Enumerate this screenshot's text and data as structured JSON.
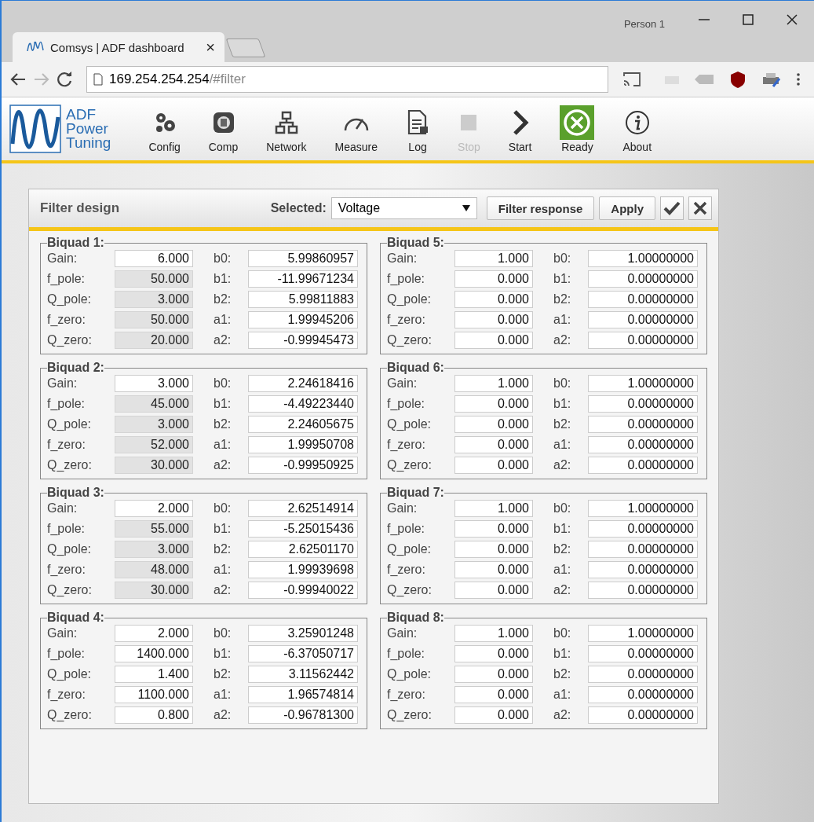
{
  "browser": {
    "profile": "Person 1",
    "tab_title": "Comsys | ADF dashboard",
    "tab_close": "×",
    "url_host": "169.254.254.254",
    "url_path": "/#filter"
  },
  "app": {
    "logo_text": [
      "ADF",
      "Power",
      "Tuning"
    ],
    "toolbar": [
      {
        "label": "Config",
        "kind": "config",
        "disabled": false
      },
      {
        "label": "Comp",
        "kind": "comp",
        "disabled": false
      },
      {
        "label": "Network",
        "kind": "network",
        "disabled": false
      },
      {
        "label": "Measure",
        "kind": "measure",
        "disabled": false
      },
      {
        "label": "Log",
        "kind": "log",
        "disabled": false
      },
      {
        "label": "Stop",
        "kind": "stop",
        "disabled": true
      },
      {
        "label": "Start",
        "kind": "start",
        "disabled": false
      },
      {
        "label": "Ready",
        "kind": "ready",
        "disabled": false
      },
      {
        "label": "About",
        "kind": "about",
        "disabled": false
      }
    ]
  },
  "panel": {
    "title": "Filter design",
    "selected_label": "Selected:",
    "selected_value": "Voltage",
    "buttons": [
      "Filter response",
      "Apply"
    ],
    "biquads": [
      {
        "title": "Biquad 1:",
        "params": [
          {
            "label": "Gain:",
            "value": "6.000",
            "disabled": false
          },
          {
            "label": "f_pole:",
            "value": "50.000",
            "disabled": true
          },
          {
            "label": "Q_pole:",
            "value": "3.000",
            "disabled": true
          },
          {
            "label": "f_zero:",
            "value": "50.000",
            "disabled": true
          },
          {
            "label": "Q_zero:",
            "value": "20.000",
            "disabled": true
          }
        ],
        "coeffs": [
          {
            "label": "b0:",
            "value": "5.99860957"
          },
          {
            "label": "b1:",
            "value": "-11.99671234"
          },
          {
            "label": "b2:",
            "value": "5.99811883"
          },
          {
            "label": "a1:",
            "value": "1.99945206"
          },
          {
            "label": "a2:",
            "value": "-0.99945473"
          }
        ]
      },
      {
        "title": "Biquad 2:",
        "params": [
          {
            "label": "Gain:",
            "value": "3.000",
            "disabled": false
          },
          {
            "label": "f_pole:",
            "value": "45.000",
            "disabled": true
          },
          {
            "label": "Q_pole:",
            "value": "3.000",
            "disabled": true
          },
          {
            "label": "f_zero:",
            "value": "52.000",
            "disabled": true
          },
          {
            "label": "Q_zero:",
            "value": "30.000",
            "disabled": true
          }
        ],
        "coeffs": [
          {
            "label": "b0:",
            "value": "2.24618416"
          },
          {
            "label": "b1:",
            "value": "-4.49223440"
          },
          {
            "label": "b2:",
            "value": "2.24605675"
          },
          {
            "label": "a1:",
            "value": "1.99950708"
          },
          {
            "label": "a2:",
            "value": "-0.99950925"
          }
        ]
      },
      {
        "title": "Biquad 3:",
        "params": [
          {
            "label": "Gain:",
            "value": "2.000",
            "disabled": false
          },
          {
            "label": "f_pole:",
            "value": "55.000",
            "disabled": true
          },
          {
            "label": "Q_pole:",
            "value": "3.000",
            "disabled": true
          },
          {
            "label": "f_zero:",
            "value": "48.000",
            "disabled": true
          },
          {
            "label": "Q_zero:",
            "value": "30.000",
            "disabled": true
          }
        ],
        "coeffs": [
          {
            "label": "b0:",
            "value": "2.62514914"
          },
          {
            "label": "b1:",
            "value": "-5.25015436"
          },
          {
            "label": "b2:",
            "value": "2.62501170"
          },
          {
            "label": "a1:",
            "value": "1.99939698"
          },
          {
            "label": "a2:",
            "value": "-0.99940022"
          }
        ]
      },
      {
        "title": "Biquad 4:",
        "params": [
          {
            "label": "Gain:",
            "value": "2.000",
            "disabled": false
          },
          {
            "label": "f_pole:",
            "value": "1400.000",
            "disabled": false
          },
          {
            "label": "Q_pole:",
            "value": "1.400",
            "disabled": false
          },
          {
            "label": "f_zero:",
            "value": "1100.000",
            "disabled": false
          },
          {
            "label": "Q_zero:",
            "value": "0.800",
            "disabled": false
          }
        ],
        "coeffs": [
          {
            "label": "b0:",
            "value": "3.25901248"
          },
          {
            "label": "b1:",
            "value": "-6.37050717"
          },
          {
            "label": "b2:",
            "value": "3.11562442"
          },
          {
            "label": "a1:",
            "value": "1.96574814"
          },
          {
            "label": "a2:",
            "value": "-0.96781300"
          }
        ]
      },
      {
        "title": "Biquad 5:",
        "params": [
          {
            "label": "Gain:",
            "value": "1.000",
            "disabled": false
          },
          {
            "label": "f_pole:",
            "value": "0.000",
            "disabled": false
          },
          {
            "label": "Q_pole:",
            "value": "0.000",
            "disabled": false
          },
          {
            "label": "f_zero:",
            "value": "0.000",
            "disabled": false
          },
          {
            "label": "Q_zero:",
            "value": "0.000",
            "disabled": false
          }
        ],
        "coeffs": [
          {
            "label": "b0:",
            "value": "1.00000000"
          },
          {
            "label": "b1:",
            "value": "0.00000000"
          },
          {
            "label": "b2:",
            "value": "0.00000000"
          },
          {
            "label": "a1:",
            "value": "0.00000000"
          },
          {
            "label": "a2:",
            "value": "0.00000000"
          }
        ]
      },
      {
        "title": "Biquad 6:",
        "params": [
          {
            "label": "Gain:",
            "value": "1.000",
            "disabled": false
          },
          {
            "label": "f_pole:",
            "value": "0.000",
            "disabled": false
          },
          {
            "label": "Q_pole:",
            "value": "0.000",
            "disabled": false
          },
          {
            "label": "f_zero:",
            "value": "0.000",
            "disabled": false
          },
          {
            "label": "Q_zero:",
            "value": "0.000",
            "disabled": false
          }
        ],
        "coeffs": [
          {
            "label": "b0:",
            "value": "1.00000000"
          },
          {
            "label": "b1:",
            "value": "0.00000000"
          },
          {
            "label": "b2:",
            "value": "0.00000000"
          },
          {
            "label": "a1:",
            "value": "0.00000000"
          },
          {
            "label": "a2:",
            "value": "0.00000000"
          }
        ]
      },
      {
        "title": "Biquad 7:",
        "params": [
          {
            "label": "Gain:",
            "value": "1.000",
            "disabled": false
          },
          {
            "label": "f_pole:",
            "value": "0.000",
            "disabled": false
          },
          {
            "label": "Q_pole:",
            "value": "0.000",
            "disabled": false
          },
          {
            "label": "f_zero:",
            "value": "0.000",
            "disabled": false
          },
          {
            "label": "Q_zero:",
            "value": "0.000",
            "disabled": false
          }
        ],
        "coeffs": [
          {
            "label": "b0:",
            "value": "1.00000000"
          },
          {
            "label": "b1:",
            "value": "0.00000000"
          },
          {
            "label": "b2:",
            "value": "0.00000000"
          },
          {
            "label": "a1:",
            "value": "0.00000000"
          },
          {
            "label": "a2:",
            "value": "0.00000000"
          }
        ]
      },
      {
        "title": "Biquad 8:",
        "params": [
          {
            "label": "Gain:",
            "value": "1.000",
            "disabled": false
          },
          {
            "label": "f_pole:",
            "value": "0.000",
            "disabled": false
          },
          {
            "label": "Q_pole:",
            "value": "0.000",
            "disabled": false
          },
          {
            "label": "f_zero:",
            "value": "0.000",
            "disabled": false
          },
          {
            "label": "Q_zero:",
            "value": "0.000",
            "disabled": false
          }
        ],
        "coeffs": [
          {
            "label": "b0:",
            "value": "1.00000000"
          },
          {
            "label": "b1:",
            "value": "0.00000000"
          },
          {
            "label": "b2:",
            "value": "0.00000000"
          },
          {
            "label": "a1:",
            "value": "0.00000000"
          },
          {
            "label": "a2:",
            "value": "0.00000000"
          }
        ]
      }
    ]
  }
}
